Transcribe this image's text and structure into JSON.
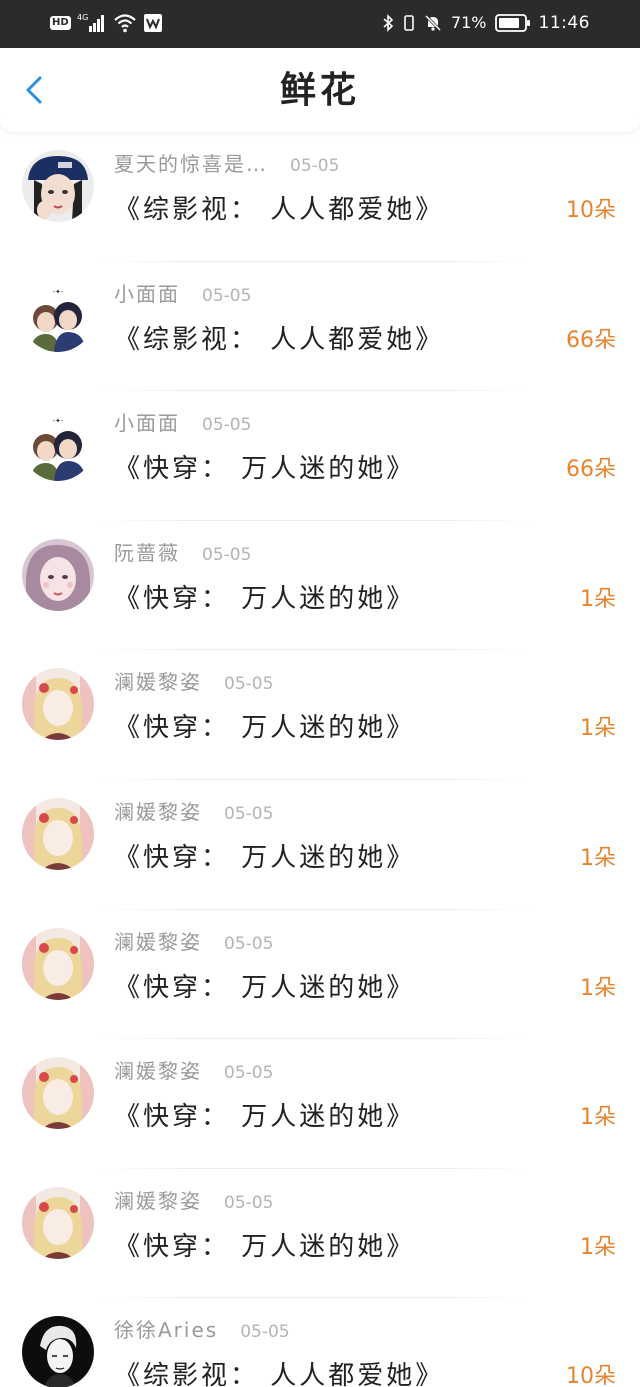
{
  "status_bar": {
    "hd": "HD",
    "network": "4G",
    "battery": "71%",
    "time": "11:46"
  },
  "header": {
    "title": "鲜花"
  },
  "rows": [
    {
      "username": "夏天的惊喜是…",
      "date": "05-05",
      "title": "《综影视： 人人都爱她》",
      "amount": "10朵",
      "avatar": "girl-cap-avatar"
    },
    {
      "username": "小面面",
      "date": "05-05",
      "title": "《综影视： 人人都爱她》",
      "amount": "66朵",
      "avatar": "couple-avatar"
    },
    {
      "username": "小面面",
      "date": "05-05",
      "title": "《快穿： 万人迷的她》",
      "amount": "66朵",
      "avatar": "couple-avatar"
    },
    {
      "username": "阮蔷薇",
      "date": "05-05",
      "title": "《快穿： 万人迷的她》",
      "amount": "1朵",
      "avatar": "pink-girl-avatar"
    },
    {
      "username": "澜媛黎姿",
      "date": "05-05",
      "title": "《快穿： 万人迷的她》",
      "amount": "1朵",
      "avatar": "flower-girl-avatar"
    },
    {
      "username": "澜媛黎姿",
      "date": "05-05",
      "title": "《快穿： 万人迷的她》",
      "amount": "1朵",
      "avatar": "flower-girl-avatar"
    },
    {
      "username": "澜媛黎姿",
      "date": "05-05",
      "title": "《快穿： 万人迷的她》",
      "amount": "1朵",
      "avatar": "flower-girl-avatar"
    },
    {
      "username": "澜媛黎姿",
      "date": "05-05",
      "title": "《快穿： 万人迷的她》",
      "amount": "1朵",
      "avatar": "flower-girl-avatar"
    },
    {
      "username": "澜媛黎姿",
      "date": "05-05",
      "title": "《快穿： 万人迷的她》",
      "amount": "1朵",
      "avatar": "flower-girl-avatar"
    },
    {
      "username": "徐徐Aries",
      "date": "05-05",
      "title": "《综影视： 人人都爱她》",
      "amount": "10朵",
      "avatar": "sketch-boy-avatar"
    }
  ],
  "colors": {
    "accent_blue": "#2a8fe0",
    "amount_orange": "#e8832e",
    "status_bar_bg": "#2b2b2b"
  }
}
